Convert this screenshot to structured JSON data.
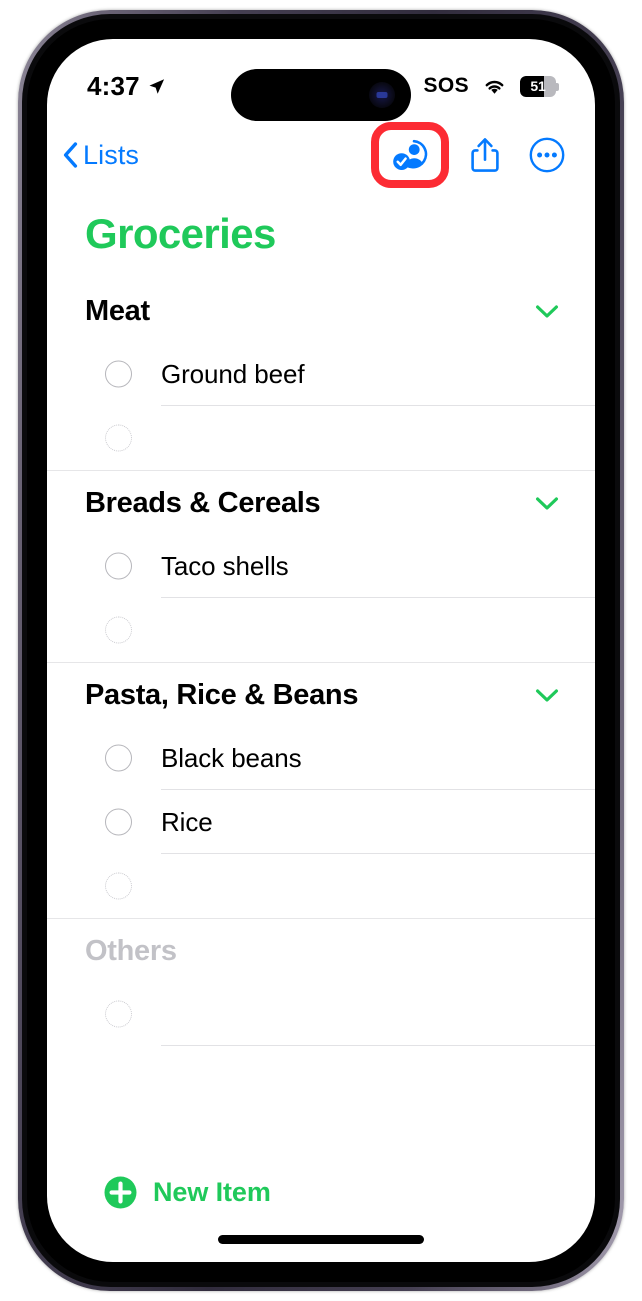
{
  "status_bar": {
    "time": "4:37",
    "location_icon": "location-arrow-icon",
    "sos_label": "SOS",
    "wifi_icon": "wifi-icon",
    "battery_percent": "51",
    "battery_fill_pct": 66
  },
  "nav_bar": {
    "back_label": "Lists",
    "back_icon": "chevron-left-icon",
    "assign_icon": "person-checkmark-icon",
    "share_icon": "share-icon",
    "more_icon": "more-circle-icon",
    "highlight_color": "#fc2b33",
    "tint_color": "#047aff"
  },
  "list": {
    "title": "Groceries",
    "title_color": "#1fc95a",
    "sections": [
      {
        "title": "Meat",
        "dimmed": false,
        "collapse_icon": "chevron-down-icon",
        "items": [
          {
            "text": "Ground beef",
            "checked": false,
            "placeholder": false
          },
          {
            "text": "",
            "checked": false,
            "placeholder": true
          }
        ]
      },
      {
        "title": "Breads & Cereals",
        "dimmed": false,
        "collapse_icon": "chevron-down-icon",
        "items": [
          {
            "text": "Taco shells",
            "checked": false,
            "placeholder": false
          },
          {
            "text": "",
            "checked": false,
            "placeholder": true
          }
        ]
      },
      {
        "title": "Pasta, Rice & Beans",
        "dimmed": false,
        "collapse_icon": "chevron-down-icon",
        "items": [
          {
            "text": "Black beans",
            "checked": false,
            "placeholder": false
          },
          {
            "text": "Rice",
            "checked": false,
            "placeholder": false
          },
          {
            "text": "",
            "checked": false,
            "placeholder": true
          }
        ]
      },
      {
        "title": "Others",
        "dimmed": true,
        "collapse_icon": null,
        "items": [
          {
            "text": "",
            "checked": false,
            "placeholder": true
          }
        ]
      }
    ]
  },
  "footer": {
    "new_item_label": "New Item",
    "new_item_icon": "plus-circle-icon",
    "accent_color": "#1fc95a"
  }
}
